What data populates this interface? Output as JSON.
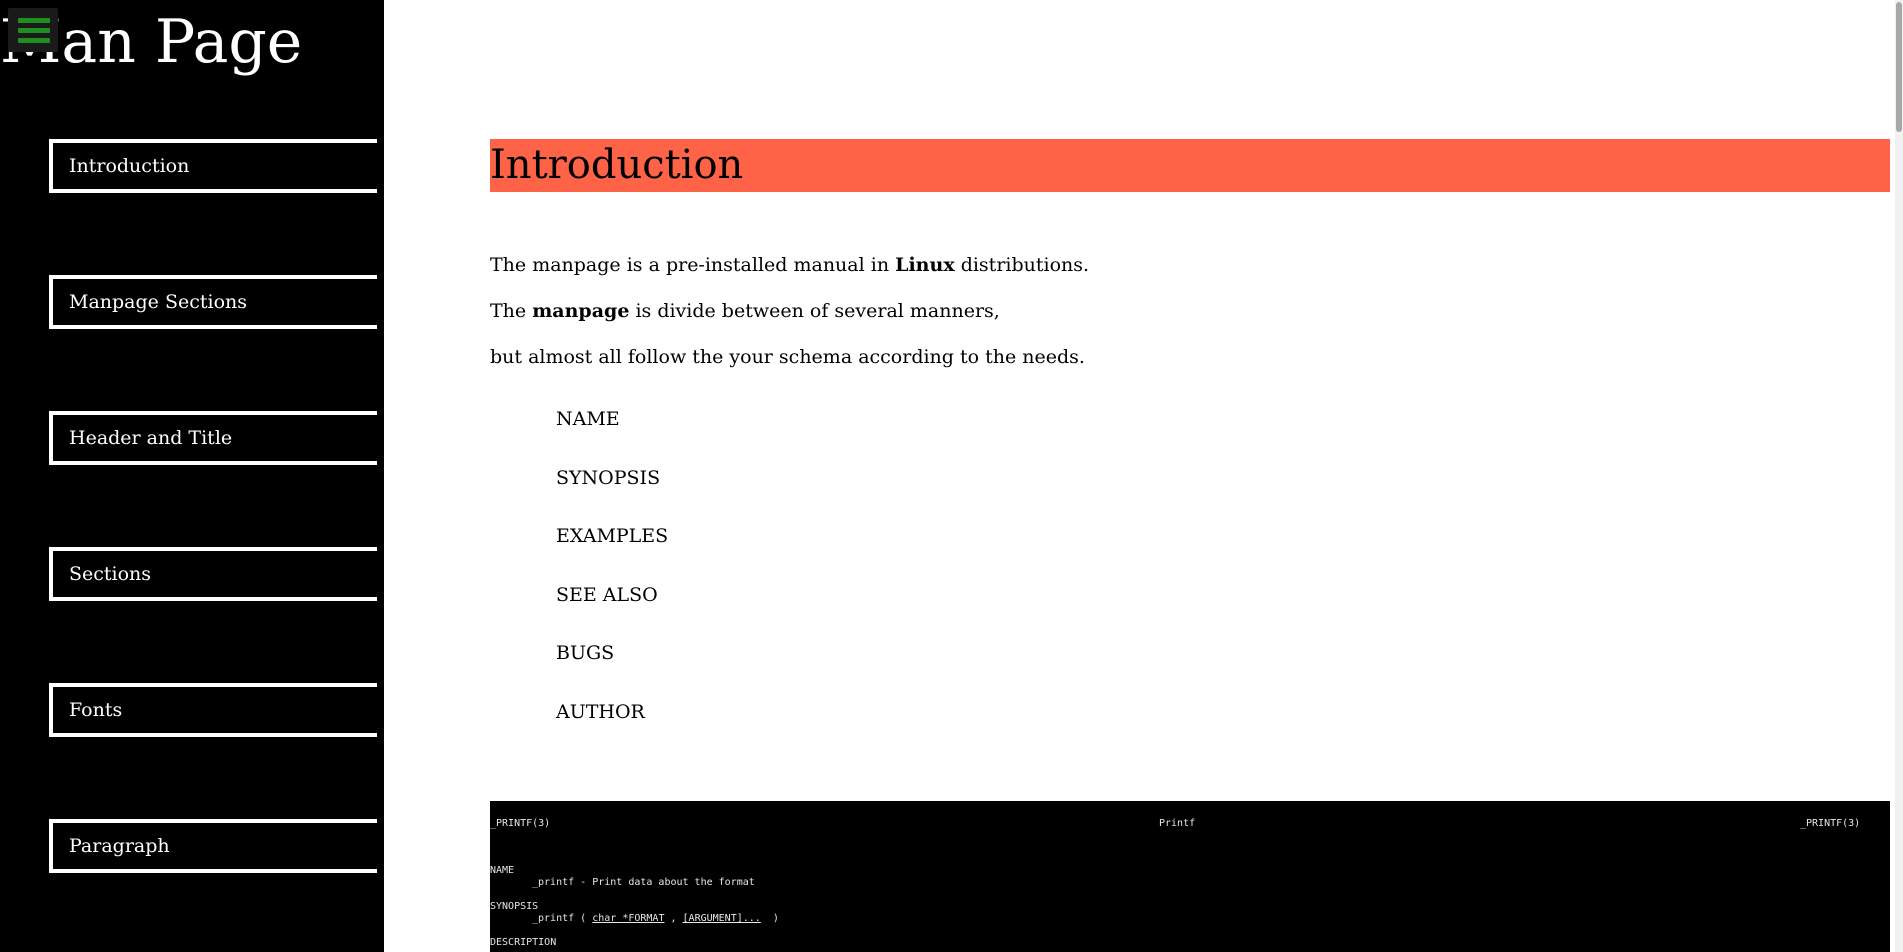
{
  "sidebar": {
    "title": "Man Page",
    "menu_icon": "hamburger-menu-icon",
    "nav": [
      {
        "label": "Introduction"
      },
      {
        "label": "Manpage Sections"
      },
      {
        "label": "Header and Title"
      },
      {
        "label": "Sections"
      },
      {
        "label": "Fonts"
      },
      {
        "label": "Paragraph"
      }
    ]
  },
  "main": {
    "heading": "Introduction",
    "heading_color": "#ff6347",
    "para1": {
      "before": "The manpage is a pre-installed manual in ",
      "bold": "Linux",
      "after": " distributions."
    },
    "para2": {
      "before": "The ",
      "bold": "manpage",
      "after": " is divide between of several manners,"
    },
    "para3": "but almost all follow the your schema according to the needs.",
    "schema": [
      "NAME",
      "SYNOPSIS",
      "EXAMPLES",
      "SEE ALSO",
      "BUGS",
      "AUTHOR"
    ],
    "terminal": {
      "header_left": "_PRINTF(3)",
      "header_center": "Printf",
      "header_right": "_PRINTF(3)",
      "name_label": "NAME",
      "name_text": "_printf - Print data about the format",
      "synopsis_label": "SYNOPSIS",
      "synopsis_fn": "_printf ( ",
      "synopsis_arg1": "char *FORMAT",
      "synopsis_sep": " , ",
      "synopsis_arg2": "[ARGUMENT]...",
      "synopsis_end": "  )",
      "description_label": "DESCRIPTION"
    }
  },
  "colors": {
    "sidebar_bg": "#000000",
    "accent": "#ff6347",
    "menu_icon": "#1f8f1f"
  }
}
